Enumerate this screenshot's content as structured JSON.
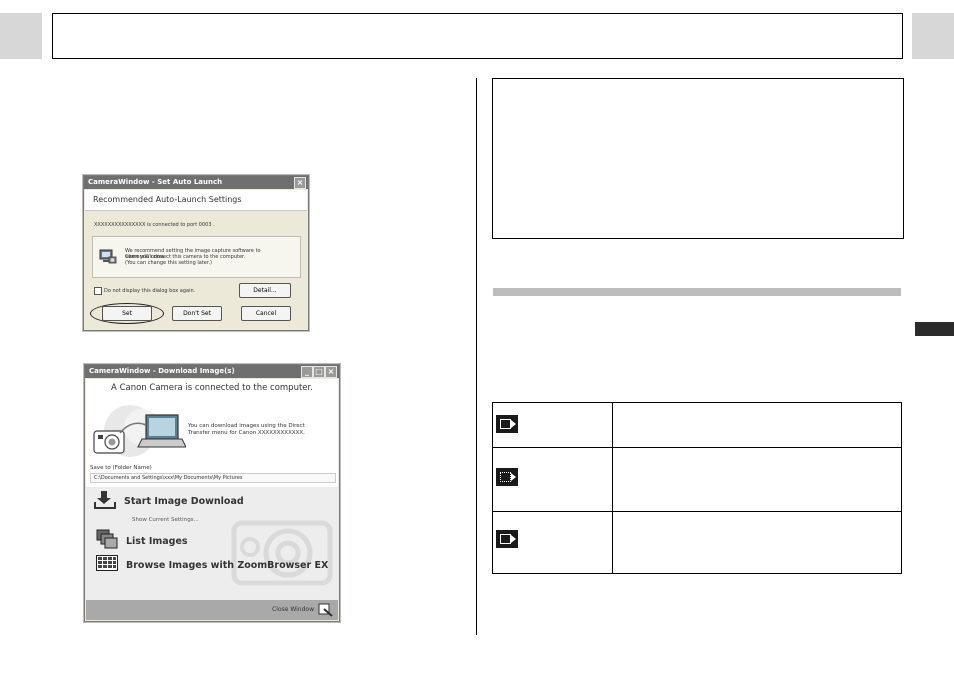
{
  "dialog_set_auto_launch": {
    "title": "CameraWindow - Set Auto Launch",
    "heading": "Recommended Auto-Launch Settings",
    "connected_text": "XXXXXXXXXXXXXXX is connected to port 0003 .",
    "recommend_text_1": "We recommend setting the image capture software to CameraWindow",
    "recommend_text_2": "when you connect this camera to the computer.",
    "recommend_text_3": "(You can change this setting later.)",
    "checkbox_label": "Do not display this dialog box again.",
    "detail_button": "Detail...",
    "set_button": "Set",
    "dont_set_button": "Don't Set",
    "cancel_button": "Cancel"
  },
  "dialog_download_images": {
    "title": "CameraWindow - Download Image(s)",
    "connected_heading": "A Canon Camera is connected to the computer.",
    "info_text_1": "You can download images using the Direct",
    "info_text_2": "Transfer menu for Canon XXXXXXXXXXXX.",
    "save_to_label": "Save to (Folder Name)",
    "save_to_path": "C:\\Documents and Settings\\xxx\\My Documents\\My Pictures",
    "start_download": "Start Image Download",
    "show_settings": "Show Current Settings...",
    "list_images": "List Images",
    "browse_images": "Browse Images with ZoomBrowser EX",
    "close_window": "Close Window"
  }
}
